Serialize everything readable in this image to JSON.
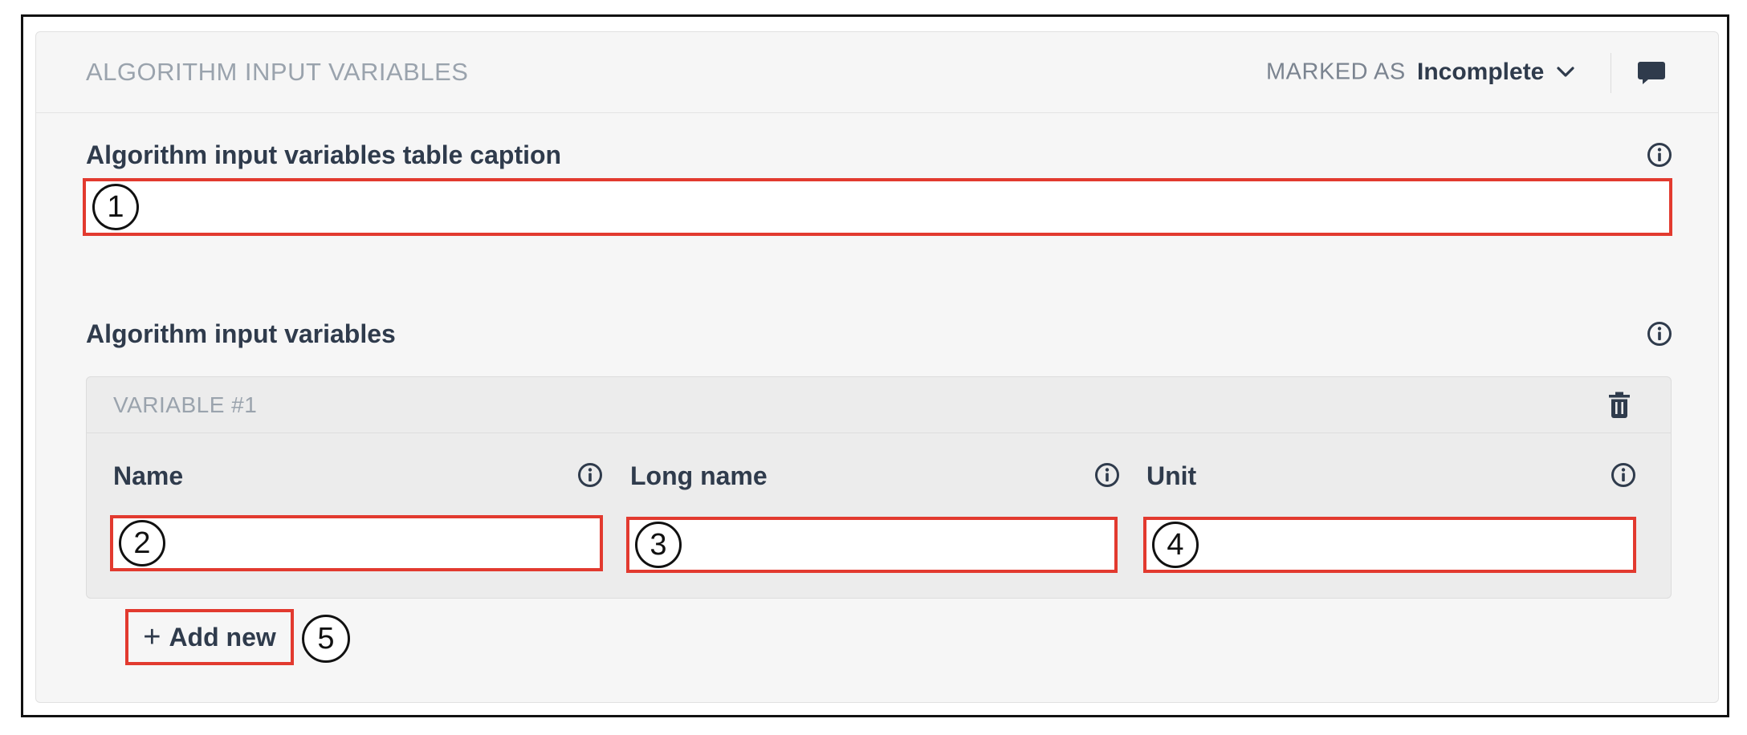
{
  "panel": {
    "title": "ALGORITHM INPUT VARIABLES",
    "marked_as_label": "MARKED AS",
    "status": "Incomplete"
  },
  "fields": {
    "caption_label": "Algorithm input variables table caption",
    "caption_value": "",
    "variables_label": "Algorithm input variables"
  },
  "variable": {
    "title": "VARIABLE #1",
    "name_label": "Name",
    "name_value": "",
    "long_name_label": "Long name",
    "long_name_value": "",
    "unit_label": "Unit",
    "unit_value": ""
  },
  "add_new": {
    "plus": "+",
    "label": "Add new"
  },
  "markers": [
    "1",
    "2",
    "3",
    "4",
    "5"
  ],
  "icons": {
    "status": "chevron-down-icon",
    "comment": "comment-icon",
    "info": "info-icon",
    "delete": "trash-icon"
  },
  "colors": {
    "highlight": "#e23a2f",
    "text": "#2f3b4c",
    "muted": "#9aa3ad",
    "panel_bg": "#f6f6f6",
    "card_bg": "#ececec"
  }
}
